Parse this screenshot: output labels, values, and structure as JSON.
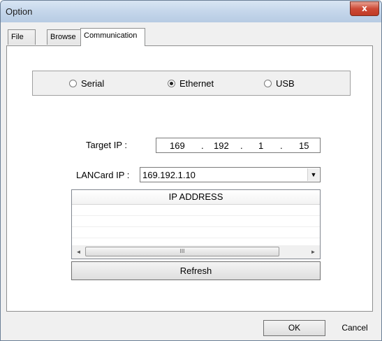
{
  "window": {
    "title": "Option",
    "close_glyph": "x"
  },
  "tabs": [
    {
      "label": "File"
    },
    {
      "label": "Browse"
    },
    {
      "label": "Communication"
    }
  ],
  "connection": {
    "options": [
      {
        "label": "Serial",
        "selected": false
      },
      {
        "label": "Ethernet",
        "selected": true
      },
      {
        "label": "USB",
        "selected": false
      }
    ]
  },
  "target_ip": {
    "label": "Target IP :",
    "octets": [
      "169",
      "192",
      "1",
      "15"
    ],
    "separator": "."
  },
  "lancard": {
    "label": "LANCard IP :",
    "value": "169.192.1.10",
    "arrow_glyph": "▼"
  },
  "ip_list": {
    "header": "IP ADDRESS",
    "rows": [],
    "scroll_left_glyph": "◄",
    "scroll_right_glyph": "►",
    "thumb_grip": "III"
  },
  "buttons": {
    "refresh": "Refresh",
    "ok": "OK",
    "cancel": "Cancel"
  }
}
